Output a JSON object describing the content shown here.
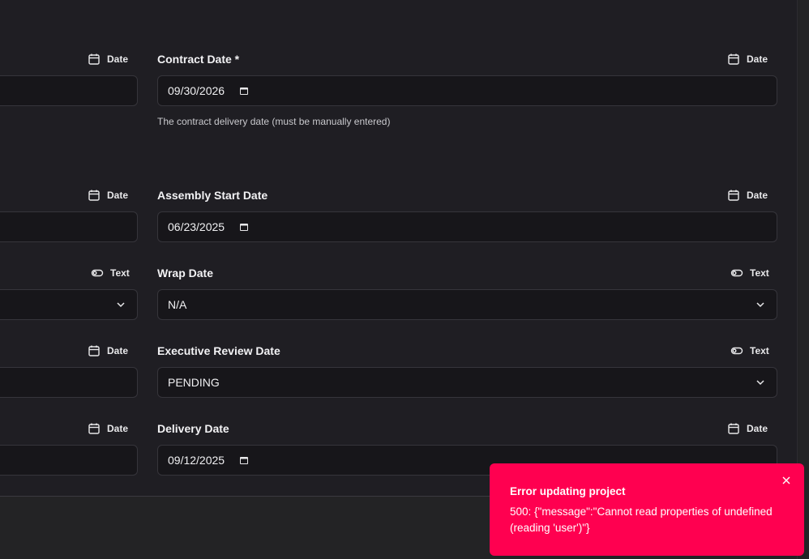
{
  "type_badges": {
    "date": "Date",
    "text": "Text"
  },
  "left_column": [],
  "right_column": {
    "contract_date": {
      "label": "Contract Date *",
      "value": "09/30/2026",
      "help": "The contract delivery date (must be manually entered)"
    },
    "assembly_start_date": {
      "label": "Assembly Start Date",
      "value": "06/23/2025"
    },
    "wrap_date": {
      "label": "Wrap Date",
      "value": "N/A"
    },
    "executive_review_date": {
      "label": "Executive Review Date",
      "value": "PENDING"
    },
    "delivery_date": {
      "label": "Delivery Date",
      "value": "09/12/2025"
    }
  },
  "toast": {
    "title": "Error updating project",
    "message": "500: {\"message\":\"Cannot read properties of undefined (reading 'user')\"}"
  },
  "icons": {
    "date": "calendar-icon",
    "text": "toggle-icon",
    "select": "chevron-down-icon",
    "close": "close-icon"
  },
  "colors": {
    "background": "#1f1e23",
    "field": "#17161a",
    "toast": "#ff0050"
  }
}
